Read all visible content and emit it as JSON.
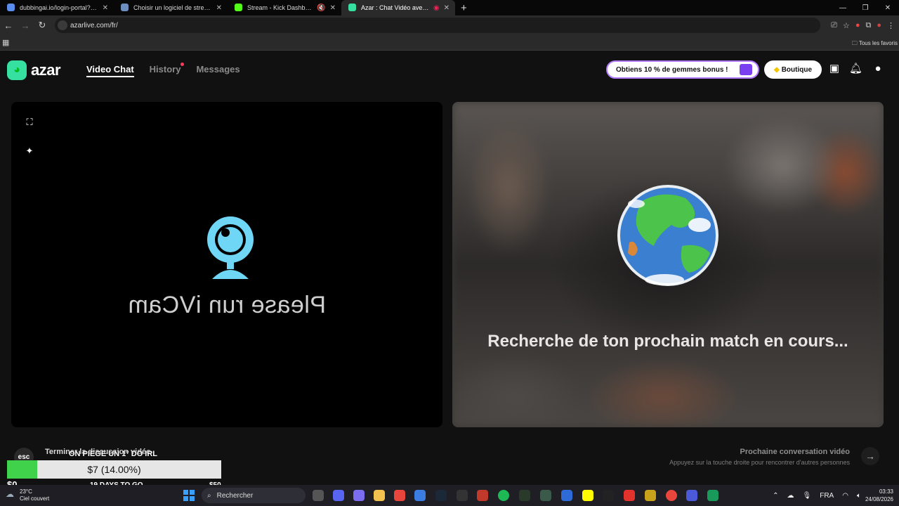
{
  "browser": {
    "tabs": [
      {
        "title": "dubbingai.io/login-portal?third",
        "active": false,
        "color": "#5a8dee"
      },
      {
        "title": "Choisir un logiciel de stream - ",
        "active": false,
        "color": "#6c8ebf"
      },
      {
        "title": "Stream - Kick Dashboard",
        "active": false,
        "color": "#53fc18"
      },
      {
        "title": "Azar : Chat Vidéo avec de n",
        "active": true,
        "color": "#36e0a0"
      }
    ],
    "url": "azarlive.com/fr/",
    "bookmarks_folder": "Tous les favoris"
  },
  "header": {
    "logo_text": "azar",
    "nav": [
      {
        "label": "Video Chat",
        "active": true
      },
      {
        "label": "History",
        "active": false,
        "has_dot": true
      },
      {
        "label": "Messages",
        "active": false
      }
    ],
    "promo_label": "Obtiens 10 % de gemmes bonus !",
    "shop_label": "Boutique"
  },
  "left_panel": {
    "camera_text": "Please run iVCam"
  },
  "right_panel": {
    "search_text": "Recherche de ton prochain match en cours..."
  },
  "bottom": {
    "esc_key": "esc",
    "end_label": "Terminer la discussion vidéo",
    "next_title": "Prochaine conversation vidéo",
    "next_sub": "Appuyez sur la touche droite pour rencontrer d'autres personnes"
  },
  "goal_overlay": {
    "title": "ON PIEGE UN 1° DO IRL",
    "amount_text": "$7 (14.00%)",
    "progress_percent": 14,
    "start_label": "$0",
    "days_label": "19 DAYS TO GO",
    "end_label": "$50"
  },
  "taskbar": {
    "temperature": "23°C",
    "weather": "Ciel couvert",
    "search_placeholder": "Rechercher",
    "language": "FRA",
    "time": "03:33",
    "date": "24/08/2026"
  },
  "colors": {
    "brand": "#36e0a0",
    "progress": "#3fd24a",
    "promo_border": "#b27aff"
  }
}
